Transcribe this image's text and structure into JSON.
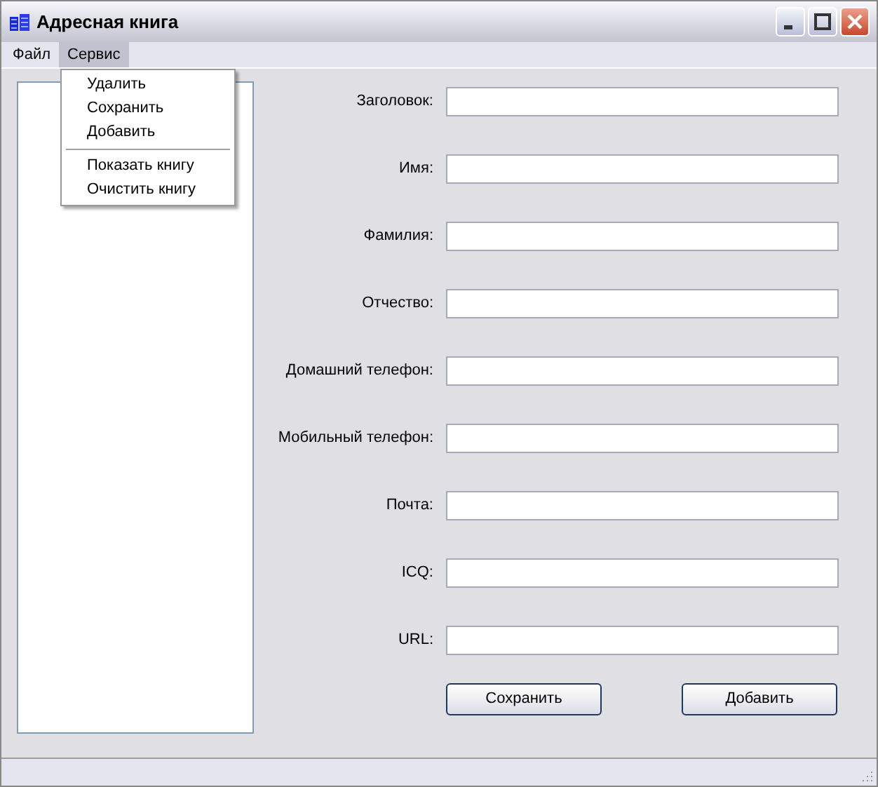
{
  "window": {
    "title": "Адресная книга"
  },
  "menu_bar": [
    {
      "label": "Файл",
      "selected": false
    },
    {
      "label": "Сервис",
      "selected": true
    }
  ],
  "dropdown": [
    {
      "kind": "item",
      "label": "Удалить"
    },
    {
      "kind": "item",
      "label": "Сохранить"
    },
    {
      "kind": "item",
      "label": "Добавить"
    },
    {
      "kind": "separator"
    },
    {
      "kind": "item",
      "label": "Показать книгу"
    },
    {
      "kind": "item",
      "label": "Очистить книгу"
    }
  ],
  "form": [
    {
      "label": "Заголовок:"
    },
    {
      "label": "Имя:"
    },
    {
      "label": "Фамилия:"
    },
    {
      "label": "Отчество:"
    },
    {
      "label": "Домашний телефон:"
    },
    {
      "label": "Мобильный телефон:"
    },
    {
      "label": "Почта:"
    },
    {
      "label": "ICQ:"
    },
    {
      "label": "URL:"
    }
  ],
  "buttons": [
    "Сохранить",
    "Добавить"
  ]
}
